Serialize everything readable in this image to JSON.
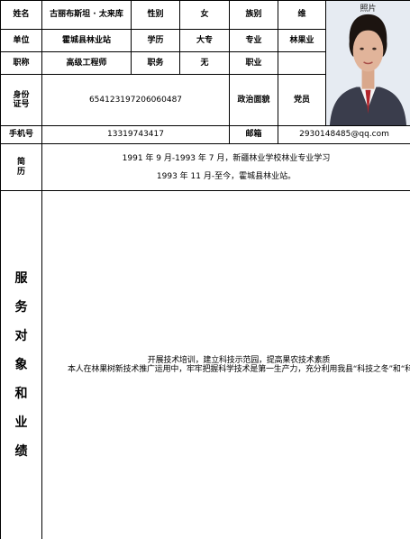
{
  "labels": {
    "name": "姓名",
    "gender": "性别",
    "ethnicity": "族别",
    "unit": "单位",
    "education": "学历",
    "major": "专业",
    "title": "职称",
    "position": "职务",
    "occupation": "职业",
    "id_top": "身份",
    "id_bottom": "证号",
    "politics": "政治面貌",
    "phone": "手机号",
    "email": "邮箱",
    "resume_a": "简",
    "resume_b": "历",
    "achievements": [
      "服",
      "务",
      "对",
      "象",
      "和",
      "业",
      "绩"
    ]
  },
  "values": {
    "name": "古丽布斯坦 · 太来库",
    "gender": "女",
    "ethnicity": "维",
    "unit": "霍城县林业站",
    "education": "大专",
    "major": "林果业",
    "title": "高级工程师",
    "position": "无",
    "occupation": "",
    "id_number": "654123197206060487",
    "politics": "党员",
    "phone": "13319743417",
    "email": "2930148485@qq.com"
  },
  "photo_caption": "照片",
  "resume": [
    "1991 年 9 月-1993 年 7 月，新疆林业学校林业专业学习",
    "1993 年 11 月-至今，霍城县林业站。"
  ],
  "achievement_paragraphs": [
    "开展技术培训，建立科技示范园，提高果农技术素质",
    "本人在林果树新技术推广运用中，牢牢把握科学技术是第一生产力，充分利用我县“科技之冬”和“科技之夏”活动，对全县林果农举办各种类型的果树技术培训班，并进行果园现场技术培训，如葡萄生长季节的修果穗、疏果粒、套袋等，樱桃李丰产树形的修剪。苹果、油桃的修剪技术及病虫害防治，生产绿色有机果品等技术内容，使果农及时掌握各类果树季节性所需的果树实用技术。几年中共培训林果农 2500 人次。分别在我县的兰干乡、三道河乡、大西沟乡、清水河镇、建立了葡萄、苹果、桃、樱桃李科技示范园，每次伊犁州及全县大型现场技术培训班都在示范园进行。在这些示范园中积极推广采用科学实用新技术、新材料，使示范园无论从产量及果品的质量都达到了规范化栽培技术要求标准，同时辐射带动了示范园所在乡镇的果农实施科学管理果园的积极性。"
  ]
}
